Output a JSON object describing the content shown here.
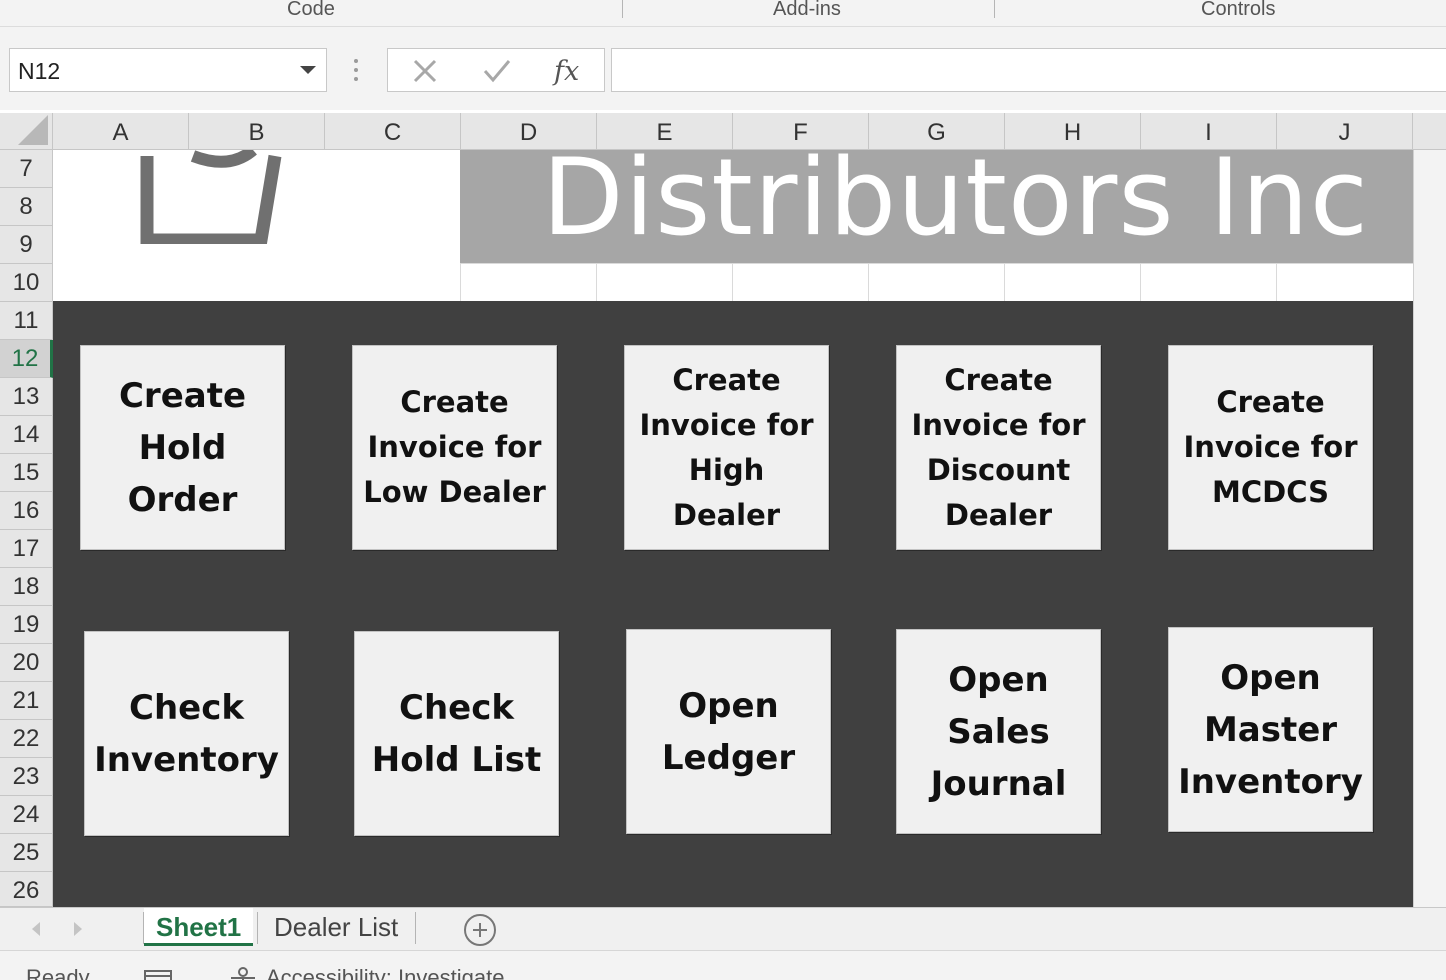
{
  "ribbon": {
    "groups": [
      "Code",
      "Add-ins",
      "Controls"
    ]
  },
  "formula_bar": {
    "name_box_value": "N12",
    "formula_value": "",
    "icons": [
      "cancel-x-icon",
      "enter-check-icon",
      "fx-icon"
    ]
  },
  "grid": {
    "columns": [
      "A",
      "B",
      "C",
      "D",
      "E",
      "F",
      "G",
      "H",
      "I",
      "J"
    ],
    "rows": [
      "7",
      "8",
      "9",
      "10",
      "11",
      "12",
      "13",
      "14",
      "15",
      "16",
      "17",
      "18",
      "19",
      "20",
      "21",
      "22",
      "23",
      "24",
      "25",
      "26"
    ],
    "active_row": "12"
  },
  "sheet": {
    "title": "Distributors Inc",
    "logo_icon": "company-logo-icon",
    "colors": {
      "title_band": "#a6a6a6",
      "panel": "#404040",
      "button": "#f0f0f0",
      "accent": "#217346"
    }
  },
  "buttons": [
    {
      "lines": [
        "Create",
        "Hold",
        "Order"
      ]
    },
    {
      "lines": [
        "Create",
        "Invoice for",
        "Low Dealer"
      ]
    },
    {
      "lines": [
        "Create",
        "Invoice for",
        "High Dealer"
      ]
    },
    {
      "lines": [
        "Create",
        "Invoice for",
        "Discount",
        "Dealer"
      ]
    },
    {
      "lines": [
        "Create",
        "Invoice for",
        "MCDCS"
      ]
    },
    {
      "lines": [
        "Check",
        "Inventory"
      ]
    },
    {
      "lines": [
        "Check",
        "Hold List"
      ]
    },
    {
      "lines": [
        "Open",
        "Ledger"
      ]
    },
    {
      "lines": [
        "Open",
        "Sales",
        "Journal"
      ]
    },
    {
      "lines": [
        "Open",
        "Master",
        "Inventory"
      ]
    }
  ],
  "tabs": {
    "sheets": [
      "Sheet1",
      "Dealer List"
    ],
    "active": "Sheet1",
    "add_icon": "add-sheet-icon"
  },
  "status": {
    "ready": "Ready",
    "accessibility": "Accessibility: Investigate"
  }
}
